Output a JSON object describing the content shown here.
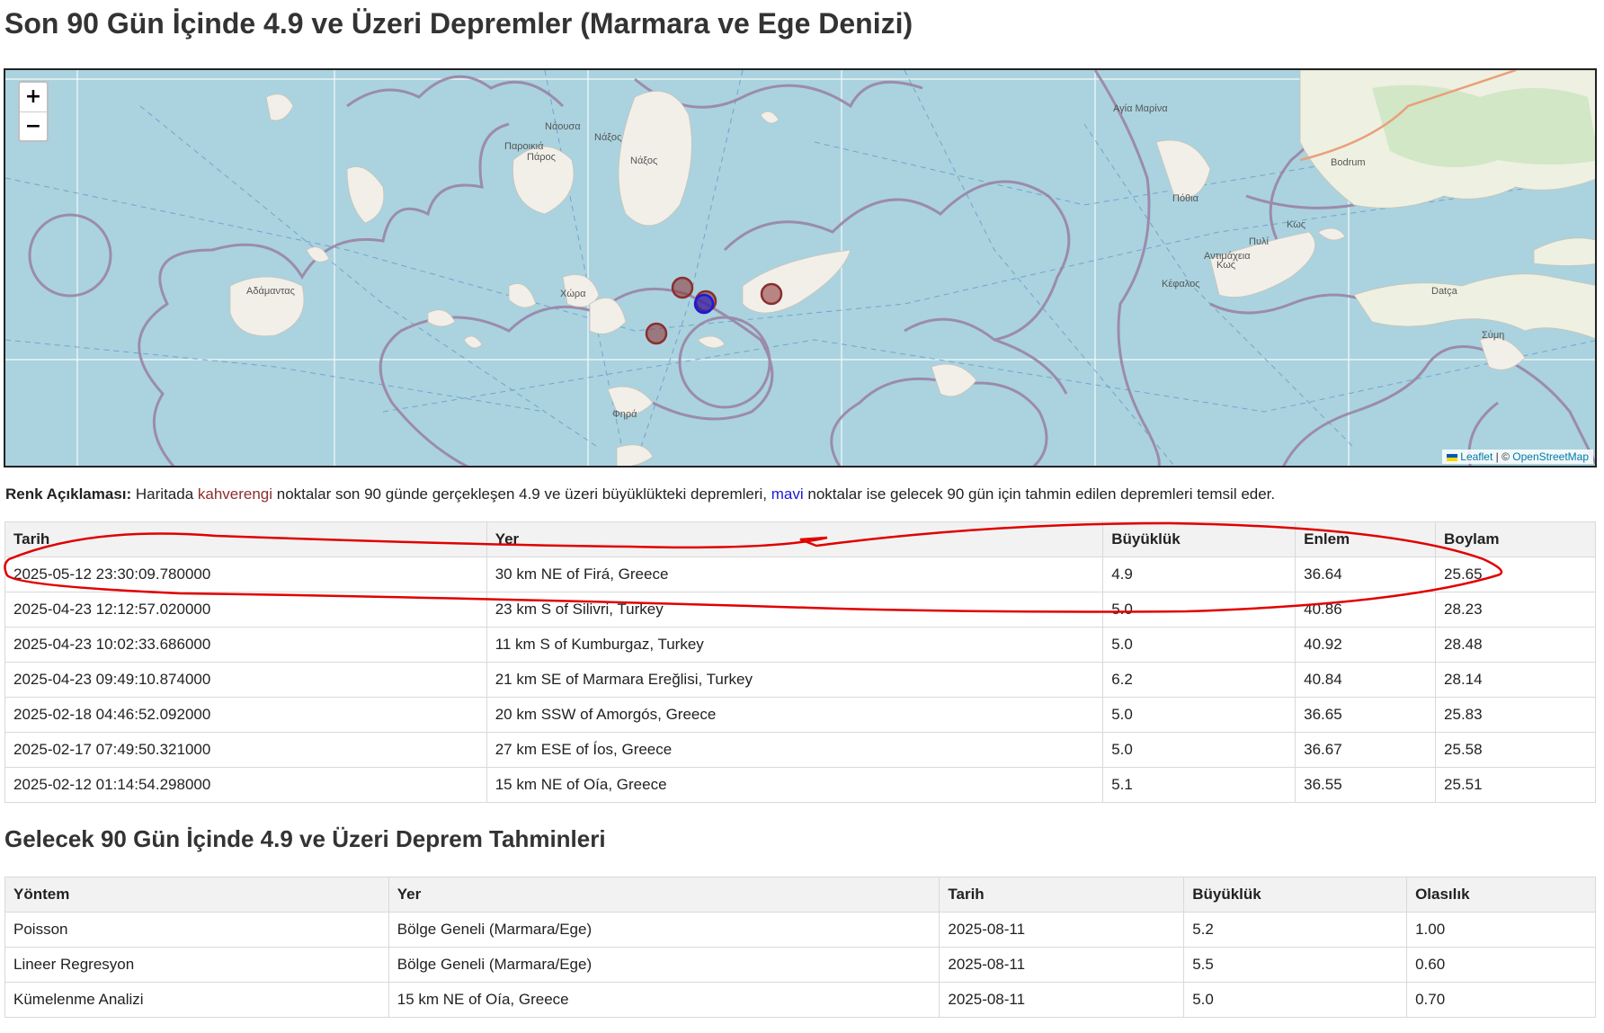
{
  "title": "Son 90 Gün İçinde 4.9 ve Üzeri Depremler (Marmara ve Ege Denizi)",
  "map": {
    "zoom_in": "+",
    "zoom_out": "−",
    "attribution_leaflet": "Leaflet",
    "attribution_sep": " | © ",
    "attribution_osm": "OpenStreetMap",
    "place_labels": [
      "Νάουσα",
      "Νάξος",
      "Παροικιά Πάρος",
      "Νάξος",
      "Αγία Μαρίνα",
      "Bodrum",
      "Πόθια",
      "Κως",
      "Πυλί",
      "Αντιμάχεια Κως",
      "Κέφαλος",
      "Datça",
      "Σύμη",
      "Αδάμαντας",
      "Χώρα",
      "Φηρά"
    ],
    "colors": {
      "water": "#aad3df",
      "land": "#f2efe9",
      "border": "#9a7fa3",
      "past": "#8b2e2e",
      "forecast": "#1a1ad6"
    }
  },
  "legend": {
    "label": "Renk Açıklaması:",
    "text1": " Haritada ",
    "brown_word": "kahverengi",
    "text2": " noktalar son 90 günde gerçekleşen 4.9 ve üzeri büyüklükteki depremleri, ",
    "blue_word": "mavi",
    "text3": " noktalar ise gelecek 90 gün için tahmin edilen depremleri temsil eder."
  },
  "earthquakes": {
    "headers": [
      "Tarih",
      "Yer",
      "Büyüklük",
      "Enlem",
      "Boylam"
    ],
    "rows": [
      [
        "2025-05-12 23:30:09.780000",
        "30 km NE of Firá, Greece",
        "4.9",
        "36.64",
        "25.65"
      ],
      [
        "2025-04-23 12:12:57.020000",
        "23 km S of Silivri, Turkey",
        "5.0",
        "40.86",
        "28.23"
      ],
      [
        "2025-04-23 10:02:33.686000",
        "11 km S of Kumburgaz, Turkey",
        "5.0",
        "40.92",
        "28.48"
      ],
      [
        "2025-04-23 09:49:10.874000",
        "21 km SE of Marmara Ereğlisi, Turkey",
        "6.2",
        "40.84",
        "28.14"
      ],
      [
        "2025-02-18 04:46:52.092000",
        "20 km SSW of Amorgós, Greece",
        "5.0",
        "36.65",
        "25.83"
      ],
      [
        "2025-02-17 07:49:50.321000",
        "27 km ESE of Íos, Greece",
        "5.0",
        "36.67",
        "25.58"
      ],
      [
        "2025-02-12 01:14:54.298000",
        "15 km NE of Oía, Greece",
        "5.1",
        "36.55",
        "25.51"
      ]
    ]
  },
  "forecast_title": "Gelecek 90 Gün İçinde 4.9 ve Üzeri Deprem Tahminleri",
  "forecasts": {
    "headers": [
      "Yöntem",
      "Yer",
      "Tarih",
      "Büyüklük",
      "Olasılık"
    ],
    "rows": [
      [
        "Poisson",
        "Bölge Geneli (Marmara/Ege)",
        "2025-08-11",
        "5.2",
        "1.00"
      ],
      [
        "Lineer Regresyon",
        "Bölge Geneli (Marmara/Ege)",
        "2025-08-11",
        "5.5",
        "0.60"
      ],
      [
        "Kümelenme Analizi",
        "15 km NE of Oía, Greece",
        "2025-08-11",
        "5.0",
        "0.70"
      ]
    ]
  }
}
